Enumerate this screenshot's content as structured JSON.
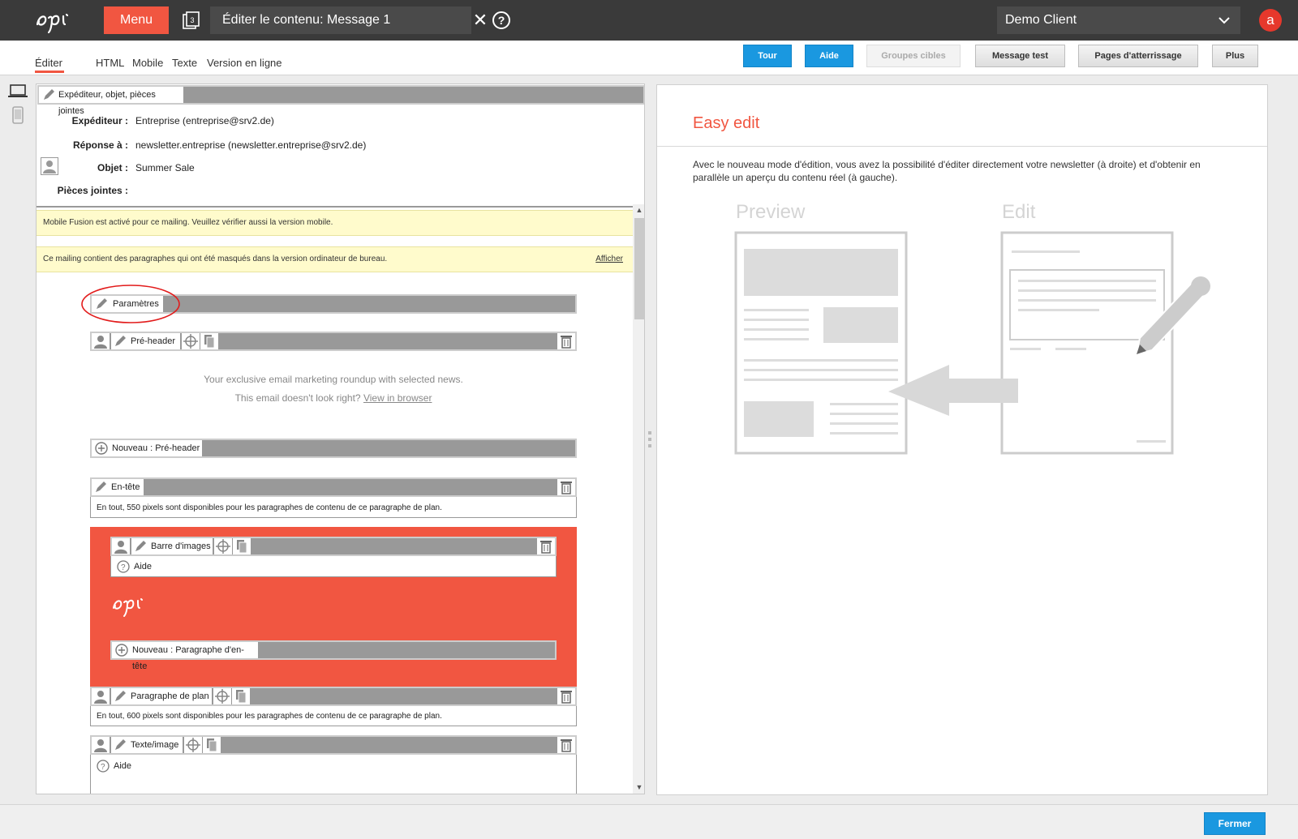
{
  "header": {
    "menu_label": "Menu",
    "cms_badge": "3",
    "title": "Éditer le contenu: Message 1",
    "close_glyph": "✕",
    "help_glyph": "?",
    "client": "Demo Client",
    "user_initial": "a"
  },
  "tabs": [
    {
      "label": "Éditer",
      "active": true
    },
    {
      "label": "HTML"
    },
    {
      "label": "Mobile"
    },
    {
      "label": "Texte"
    },
    {
      "label": "Version en ligne"
    }
  ],
  "toolbar": {
    "tour": "Tour",
    "aide": "Aide",
    "groupes_cibles": "Groupes cibles",
    "message_test": "Message test",
    "pages_atterrissage": "Pages d'atterrissage",
    "plus": "Plus"
  },
  "envelope": {
    "section_label": "Expéditeur, objet, pièces jointes",
    "sender_label": "Expéditeur :",
    "sender_value": "Entreprise (entreprise@srv2.de)",
    "reply_label": "Réponse à :",
    "reply_value": "newsletter.entreprise (newsletter.entreprise@srv2.de)",
    "subject_label": "Objet :",
    "subject_value": "Summer Sale",
    "attachments_label": "Pièces jointes :"
  },
  "notices": {
    "mobile_fusion": "Mobile Fusion est activé pour ce mailing. Veuillez vérifier aussi la version mobile.",
    "hidden_paragraphs": "Ce mailing contient des paragraphes qui ont été masqués dans la version ordinateur de bureau.",
    "show_link": "Afficher"
  },
  "editor": {
    "parametres": "Paramètres",
    "preheader": "Pré-header",
    "preheader_line1": "Your exclusive email marketing roundup with selected news.",
    "preheader_line2": "This email doesn't look right?",
    "view_in_browser": "View in browser",
    "new_preheader": "Nouveau : Pré-header",
    "entete": "En-tête",
    "entete_info": "En tout, 550 pixels sont disponibles pour les paragraphes de contenu de ce paragraphe de plan.",
    "barre_images": "Barre d'images",
    "aide": "Aide",
    "new_header_para": "Nouveau : Paragraphe d'en-tête",
    "paragraphe_plan": "Paragraphe de plan",
    "plan_info": "En tout, 600 pixels sont disponibles pour les paragraphes de contenu de ce paragraphe de plan.",
    "texte_image": "Texte/image",
    "aide2": "Aide"
  },
  "easy_edit": {
    "title": "Easy edit",
    "description": "Avec le nouveau mode d'édition, vous avez la possibilité d'éditer directement votre newsletter (à droite) et d'obtenir en parallèle un aperçu du contenu réel (à gauche).",
    "preview_label": "Preview",
    "edit_label": "Edit"
  },
  "footer": {
    "fermer": "Fermer"
  },
  "colors": {
    "brand_red": "#f15641",
    "accent_blue": "#1a98e0",
    "topbar": "#3a3a3a"
  }
}
